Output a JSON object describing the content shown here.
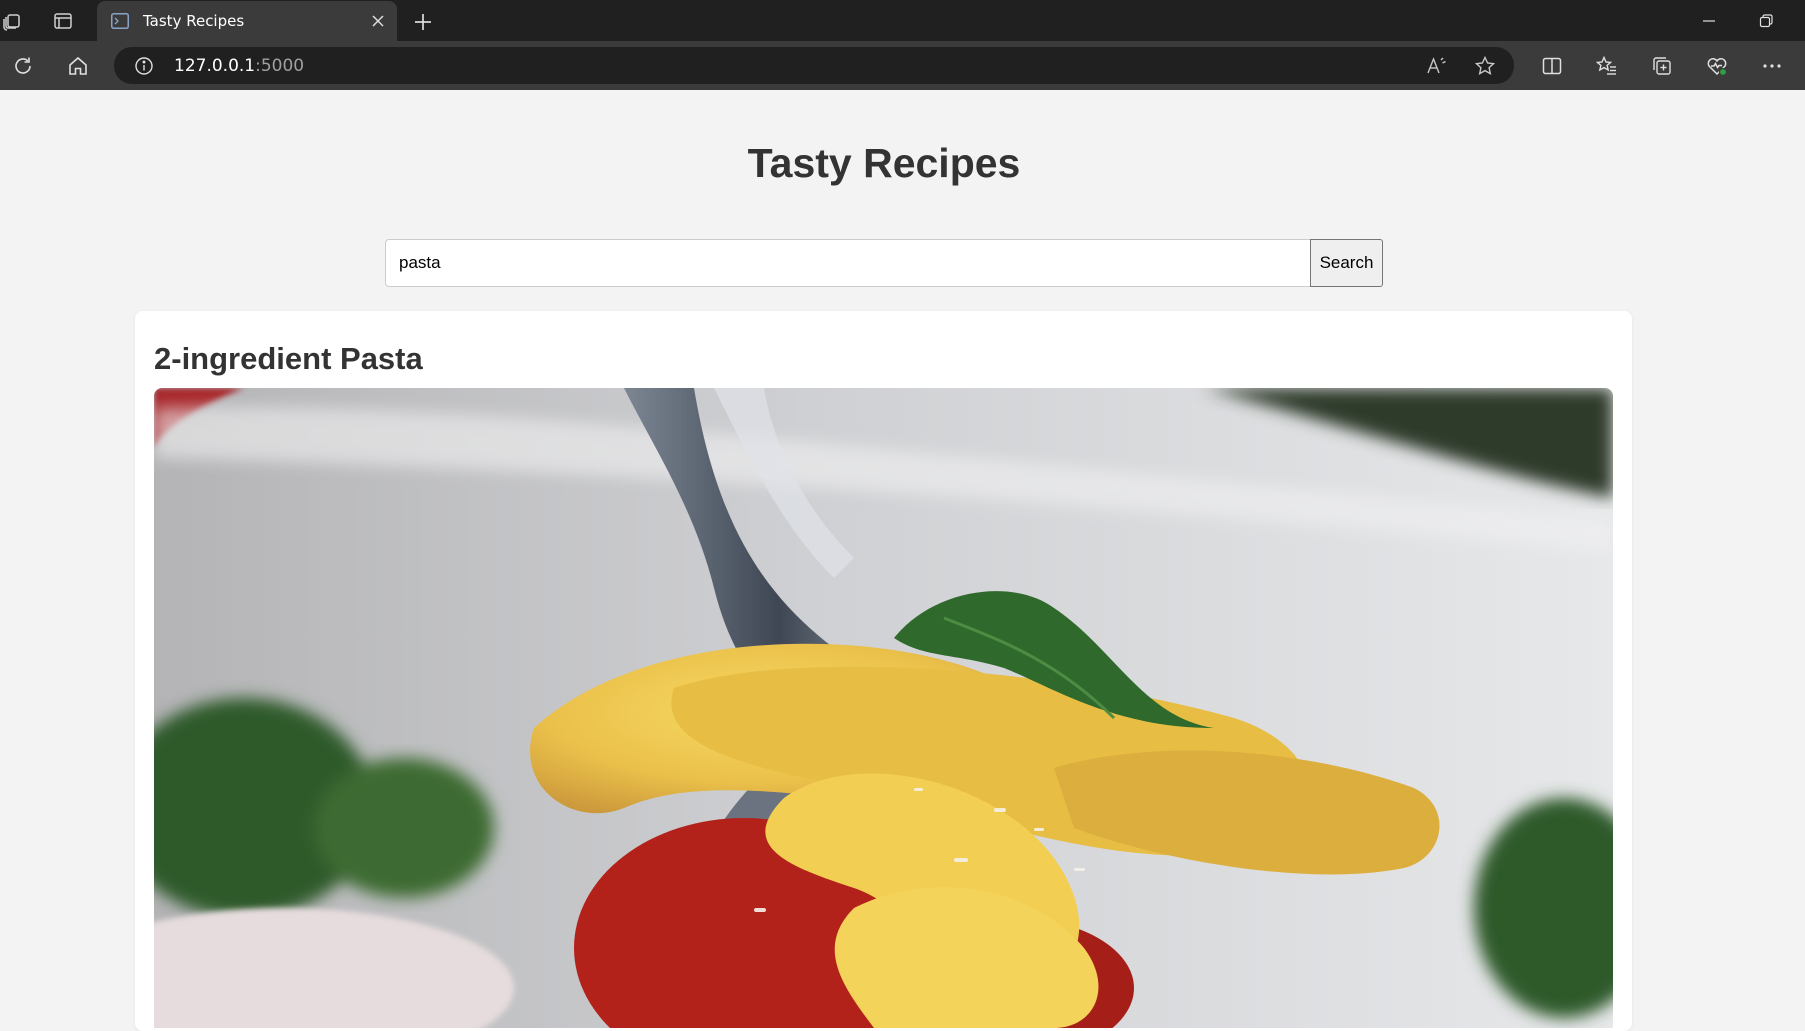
{
  "browser": {
    "tab": {
      "title": "Tasty Recipes"
    },
    "address": {
      "host": "127.0.0.1",
      "port": ":5000"
    }
  },
  "page": {
    "site_title": "Tasty Recipes",
    "search": {
      "value": "pasta",
      "button_label": "Search"
    },
    "results": [
      {
        "title": "2-ingredient Pasta"
      }
    ]
  },
  "icons": {
    "tab_actions": "workspaces-icon",
    "vertical_tabs": "tab-actions-icon",
    "refresh": "refresh-icon",
    "home": "home-icon",
    "info": "info-icon",
    "read_aloud": "read-aloud-icon",
    "favorite": "star-icon",
    "split": "split-screen-icon",
    "favorites": "favorites-icon",
    "collections": "collections-icon",
    "health": "browser-essentials-icon",
    "menu": "more-icon"
  },
  "colors": {
    "tabbar": "#202020",
    "toolbar": "#3b3b3b",
    "page_bg": "#f3f3f3",
    "heading": "#333333"
  }
}
